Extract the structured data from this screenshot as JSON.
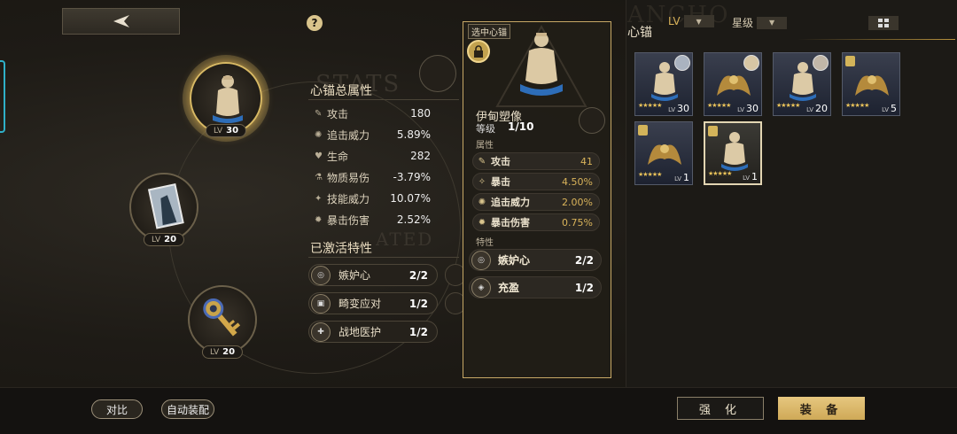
{
  "header": {
    "help_glyph": "?"
  },
  "nodes": [
    {
      "lv_label": "LV",
      "lv_value": "30"
    },
    {
      "lv_label": "LV",
      "lv_value": "20"
    },
    {
      "lv_label": "LV",
      "lv_value": "20"
    }
  ],
  "stats": {
    "title": "心锚总属性",
    "watermark_top": "STATS",
    "watermark_mid": "ATED",
    "rows": [
      {
        "label": "攻击",
        "value": "180"
      },
      {
        "label": "追击威力",
        "value": "5.89%"
      },
      {
        "label": "生命",
        "value": "282"
      },
      {
        "label": "物质易伤",
        "value": "-3.79%"
      },
      {
        "label": "技能威力",
        "value": "10.07%"
      },
      {
        "label": "暴击伤害",
        "value": "2.52%"
      }
    ]
  },
  "traits": {
    "title": "已激活特性",
    "items": [
      {
        "name": "嫉妒心",
        "count": "2/2"
      },
      {
        "name": "畸变应对",
        "count": "1/2"
      },
      {
        "name": "战地医护",
        "count": "1/2"
      }
    ]
  },
  "detail": {
    "tag": "选中心锚",
    "name": "伊甸塑像",
    "level_label": "等级",
    "level_value": "1/10",
    "attr_title": "属性",
    "attrs": [
      {
        "label": "攻击",
        "value": "41"
      },
      {
        "label": "暴击",
        "value": "4.50%"
      },
      {
        "label": "追击威力",
        "value": "2.00%"
      },
      {
        "label": "暴击伤害",
        "value": "0.75%"
      }
    ],
    "trait_title": "特性",
    "traits": [
      {
        "name": "嫉妒心",
        "count": "2/2"
      },
      {
        "name": "充盈",
        "count": "1/2"
      }
    ]
  },
  "inventory": {
    "title": "心锚",
    "bg_text": "ANCHO",
    "filter_lv": "LV",
    "filter_star": "星级",
    "dropdown_glyph": "▼",
    "cards": [
      {
        "kind": "statue",
        "lv_label": "LV",
        "lv": "30",
        "stars": "★★★★★"
      },
      {
        "kind": "wings",
        "lv_label": "LV",
        "lv": "30",
        "stars": "★★★★★"
      },
      {
        "kind": "statue",
        "lv_label": "LV",
        "lv": "20",
        "stars": "★★★★★"
      },
      {
        "kind": "wings",
        "lv_label": "LV",
        "lv": "5",
        "stars": "★★★★★"
      },
      {
        "kind": "wings",
        "lv_label": "LV",
        "lv": "1",
        "stars": "★★★★★"
      },
      {
        "kind": "statue",
        "lv_label": "LV",
        "lv": "1",
        "stars": "★★★★★"
      }
    ]
  },
  "footer": {
    "compare": "对比",
    "auto_equip": "自动装配",
    "enhance": "强 化",
    "equip": "装 备"
  },
  "colors": {
    "gold": "#c7a866",
    "accent_cyan": "#2fb0c8",
    "value_gold": "#d9b35a"
  }
}
